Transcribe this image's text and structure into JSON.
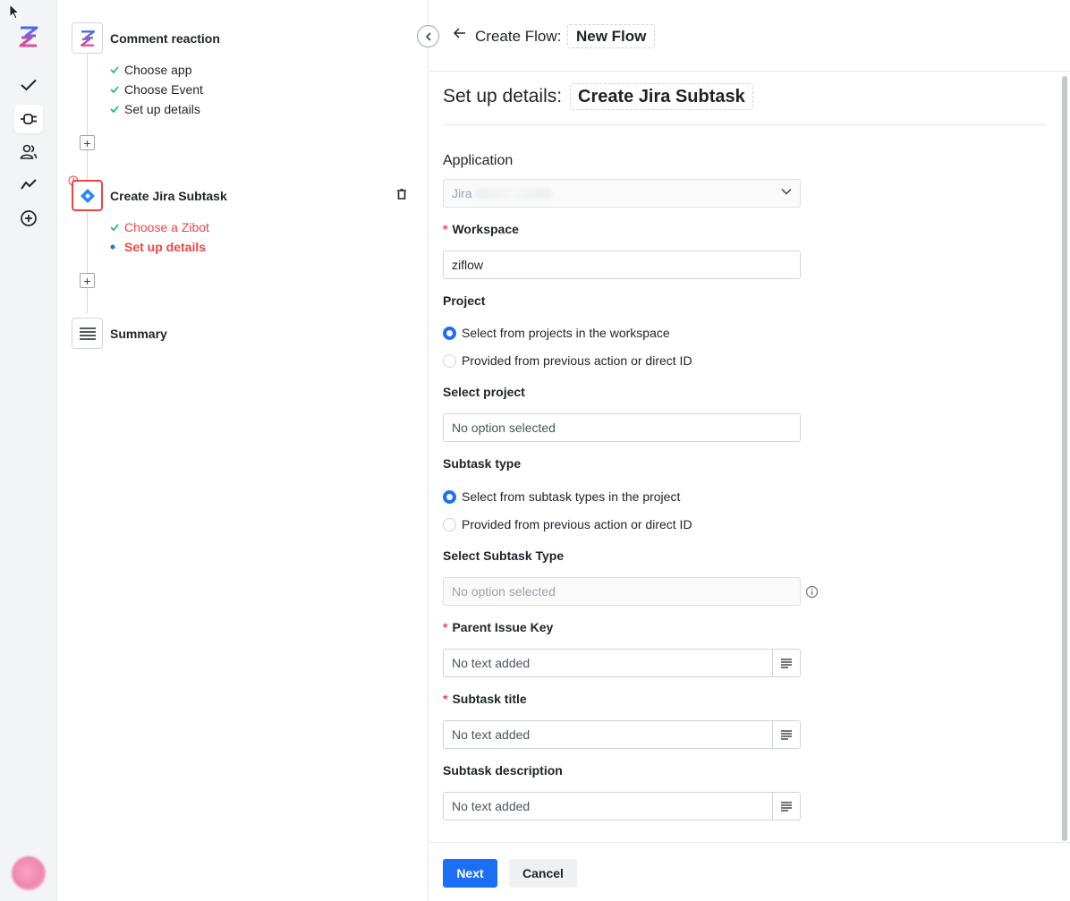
{
  "steps": {
    "trigger": {
      "title": "Comment reaction",
      "substeps": [
        "Choose app",
        "Choose Event",
        "Set up details"
      ]
    },
    "action": {
      "title": "Create Jira Subtask",
      "substeps": [
        "Choose a Zibot",
        "Set up details"
      ]
    },
    "summary": {
      "title": "Summary"
    }
  },
  "header": {
    "breadcrumb": "Create Flow:",
    "flow_name": "New Flow"
  },
  "form": {
    "title": "Set up details:",
    "action_name": "Create Jira Subtask",
    "application": {
      "label": "Application",
      "value": "Jira"
    },
    "workspace": {
      "label": "Workspace",
      "value": "ziflow"
    },
    "project": {
      "label": "Project",
      "options": [
        "Select from projects in the workspace",
        "Provided from previous action or direct ID"
      ],
      "selected_index": 0
    },
    "select_project": {
      "label": "Select project",
      "placeholder": "No option selected"
    },
    "subtask_type": {
      "label": "Subtask type",
      "options": [
        "Select from subtask types in the project",
        "Provided from previous action or direct ID"
      ],
      "selected_index": 0
    },
    "select_subtask_type": {
      "label": "Select Subtask Type",
      "placeholder": "No option selected"
    },
    "parent_issue_key": {
      "label": "Parent Issue Key",
      "placeholder": "No text added"
    },
    "subtask_title": {
      "label": "Subtask title",
      "placeholder": "No text added"
    },
    "subtask_description": {
      "label": "Subtask description",
      "placeholder": "No text added"
    }
  },
  "footer": {
    "next": "Next",
    "cancel": "Cancel"
  },
  "colors": {
    "accent": "#1a6ff5",
    "error": "#ef4444",
    "success": "#10b981"
  }
}
